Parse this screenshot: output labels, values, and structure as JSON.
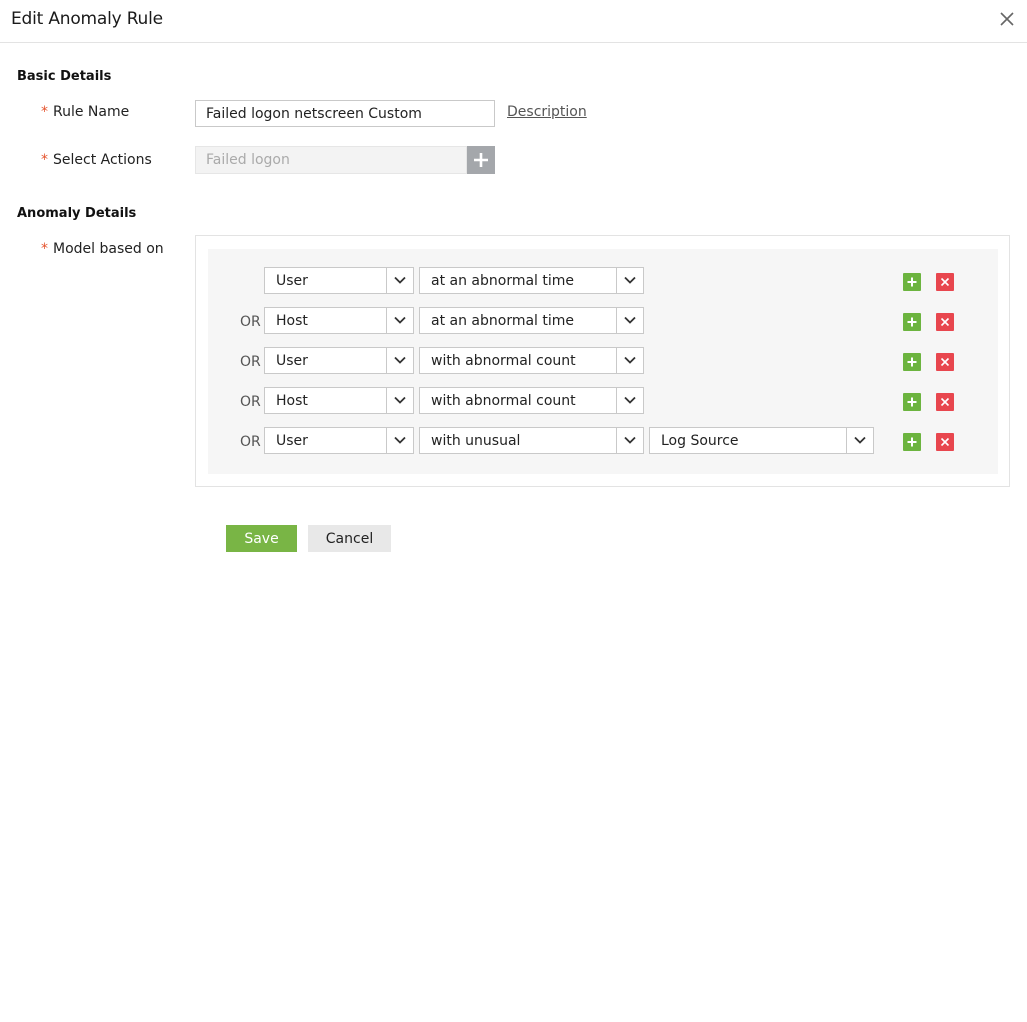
{
  "dialog": {
    "title": "Edit Anomaly Rule",
    "close_icon": "close-icon"
  },
  "basic_details": {
    "heading": "Basic Details",
    "rule_name": {
      "required_mark": "*",
      "label": "Rule Name",
      "value": "Failed logon netscreen Custom",
      "description_link": "Description"
    },
    "select_actions": {
      "required_mark": "*",
      "label": "Select Actions",
      "value": "Failed logon",
      "add_icon": "plus-icon"
    }
  },
  "anomaly_details": {
    "heading": "Anomaly Details",
    "model": {
      "required_mark": "*",
      "label": "Model based on",
      "rows": [
        {
          "connector": "",
          "entity": "User",
          "condition": "at an abnormal time",
          "extra": ""
        },
        {
          "connector": "OR",
          "entity": "Host",
          "condition": "at an abnormal time",
          "extra": ""
        },
        {
          "connector": "OR",
          "entity": "User",
          "condition": "with abnormal count",
          "extra": ""
        },
        {
          "connector": "OR",
          "entity": "Host",
          "condition": "with abnormal count",
          "extra": ""
        },
        {
          "connector": "OR",
          "entity": "User",
          "condition": "with unusual",
          "extra": "Log Source"
        }
      ]
    }
  },
  "footer": {
    "save_label": "Save",
    "cancel_label": "Cancel"
  },
  "colors": {
    "required": "#e5532d",
    "save_button": "#79b545",
    "add_row": "#6cb43f",
    "delete_row": "#e8464e",
    "actions_add_button": "#a4a7ab"
  }
}
